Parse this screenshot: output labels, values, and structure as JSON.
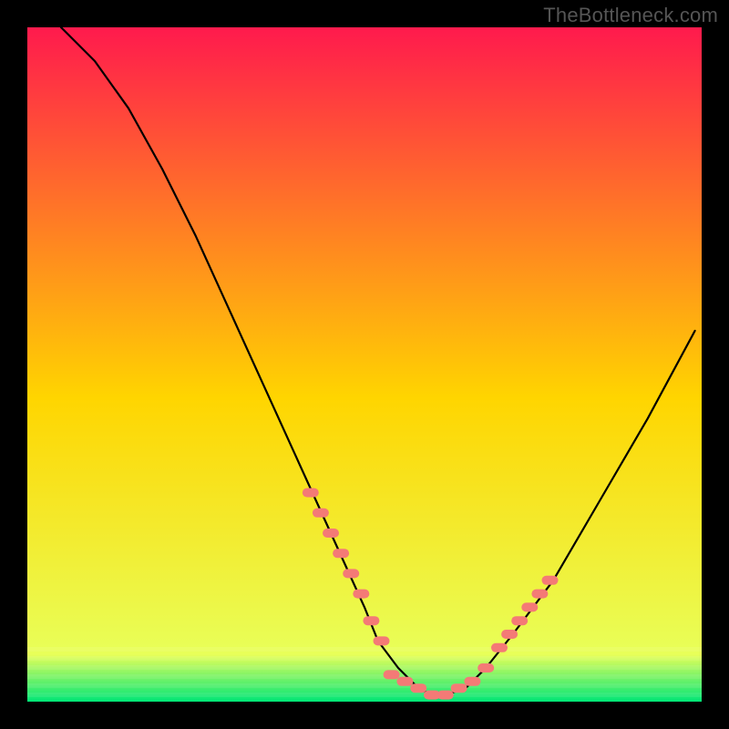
{
  "watermark": "TheBottleneck.com",
  "chart_data": {
    "type": "line",
    "title": "",
    "xlabel": "",
    "ylabel": "",
    "xlim": [
      0,
      100
    ],
    "ylim": [
      0,
      100
    ],
    "grid": false,
    "legend": false,
    "background_gradient": {
      "top_color": "#ff1a4d",
      "mid_color": "#ffd500",
      "bottom_color": "#00e676"
    },
    "series": [
      {
        "name": "bottleneck-curve",
        "color": "#000000",
        "x": [
          5,
          10,
          15,
          20,
          25,
          30,
          35,
          40,
          45,
          50,
          52,
          55,
          58,
          60,
          62,
          65,
          68,
          72,
          78,
          85,
          92,
          99
        ],
        "values": [
          100,
          95,
          88,
          79,
          69,
          58,
          47,
          36,
          25,
          14,
          9,
          5,
          2,
          1,
          1,
          2,
          5,
          10,
          18,
          30,
          42,
          55
        ]
      }
    ],
    "marker_groups": [
      {
        "name": "left-branch-dots",
        "color": "#f47a76",
        "x": [
          42,
          43.5,
          45,
          46.5,
          48,
          49.5,
          51,
          52.5
        ],
        "values": [
          31,
          28,
          25,
          22,
          19,
          16,
          12,
          9
        ]
      },
      {
        "name": "valley-dots",
        "color": "#f47a76",
        "x": [
          54,
          56,
          58,
          60,
          62,
          64,
          66,
          68
        ],
        "values": [
          4,
          3,
          2,
          1,
          1,
          2,
          3,
          5
        ]
      },
      {
        "name": "right-branch-dots",
        "color": "#f47a76",
        "x": [
          70,
          71.5,
          73,
          74.5,
          76,
          77.5
        ],
        "values": [
          8,
          10,
          12,
          14,
          16,
          18
        ]
      }
    ]
  }
}
